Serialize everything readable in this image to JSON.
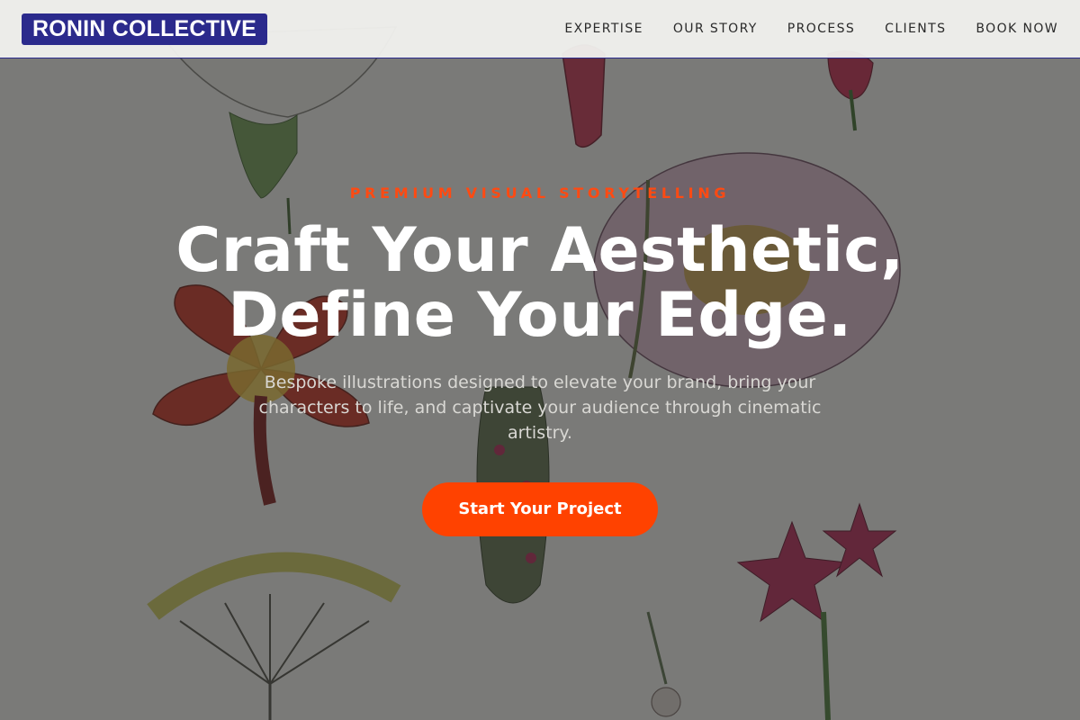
{
  "brand": {
    "logo_text": "RONIN COLLECTIVE",
    "accent_color": "#ff4200",
    "brand_color": "#2b2a8c"
  },
  "nav": {
    "items": [
      {
        "label": "EXPERTISE"
      },
      {
        "label": "OUR STORY"
      },
      {
        "label": "PROCESS"
      },
      {
        "label": "CLIENTS"
      },
      {
        "label": "BOOK NOW"
      }
    ]
  },
  "hero": {
    "eyebrow": "PREMIUM VISUAL STORYTELLING",
    "headline_line1": "Craft Your Aesthetic,",
    "headline_line2": "Define Your Edge.",
    "subtitle": "Bespoke illustrations designed to elevate your brand, bring your characters to life, and captivate your audience through cinematic artistry.",
    "cta_label": "Start Your Project"
  }
}
